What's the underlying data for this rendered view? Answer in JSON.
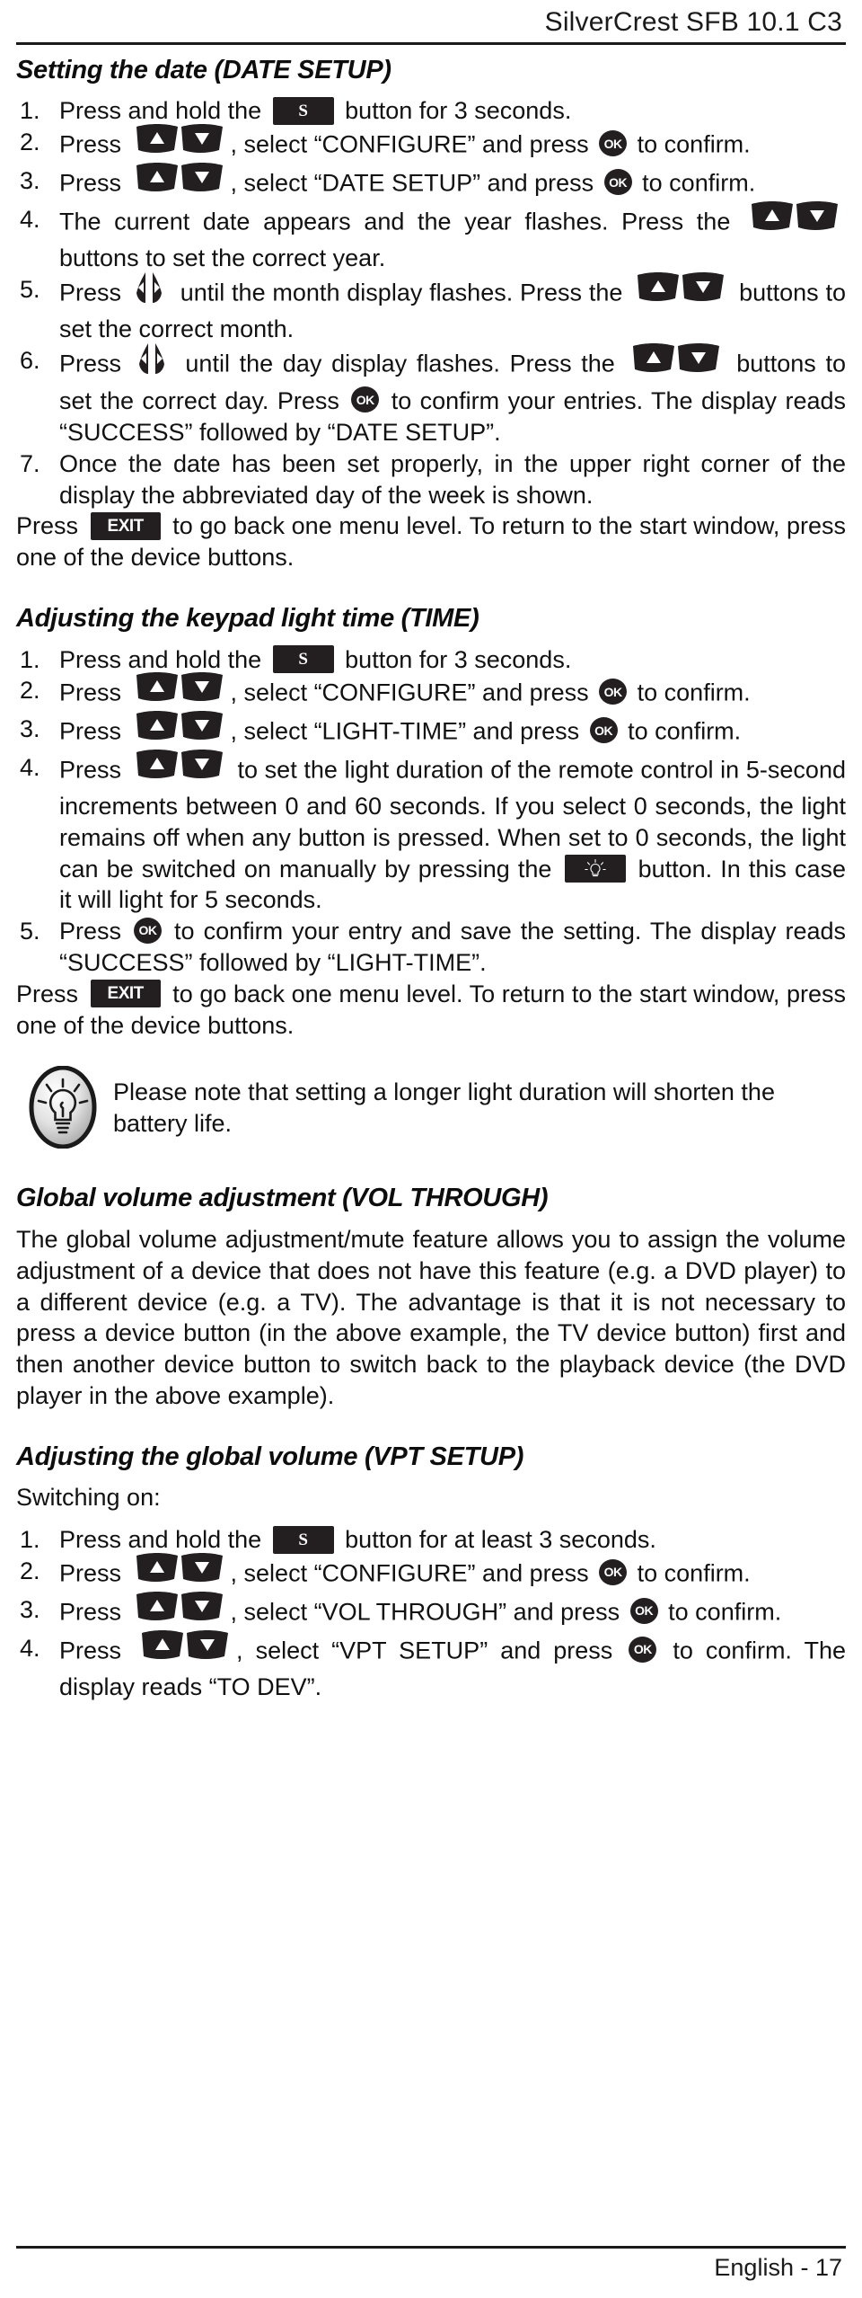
{
  "header": {
    "title": "SilverCrest SFB 10.1 C3"
  },
  "footer": {
    "text": "English - 17"
  },
  "icons": {
    "s_button_label": "S",
    "ok_button_label": "OK",
    "exit_button_label": "EXIT",
    "light_button_name": "light-bulb-icon",
    "updown_name": "up-down-rocker-icon",
    "leftright_name": "left-right-rocker-icon",
    "note_bulb_name": "note-lightbulb-icon"
  },
  "sections": [
    {
      "id": "date-setup",
      "title": "Setting the date (DATE SETUP)",
      "steps": [
        {
          "num": "1.",
          "parts": [
            {
              "t": "text",
              "v": "Press and hold the "
            },
            {
              "t": "icon",
              "v": "s"
            },
            {
              "t": "text",
              "v": " button for 3 seconds."
            }
          ]
        },
        {
          "num": "2.",
          "parts": [
            {
              "t": "text",
              "v": "Press "
            },
            {
              "t": "icon",
              "v": "updown"
            },
            {
              "t": "text",
              "v": ", select “CONFIGURE” and press "
            },
            {
              "t": "icon",
              "v": "ok"
            },
            {
              "t": "text",
              "v": " to confirm."
            }
          ]
        },
        {
          "num": "3.",
          "parts": [
            {
              "t": "text",
              "v": "Press "
            },
            {
              "t": "icon",
              "v": "updown"
            },
            {
              "t": "text",
              "v": ", select “DATE SETUP” and press "
            },
            {
              "t": "icon",
              "v": "ok"
            },
            {
              "t": "text",
              "v": " to confirm."
            }
          ]
        },
        {
          "num": "4.",
          "parts": [
            {
              "t": "text",
              "v": "The current date appears and the year flashes. Press the "
            },
            {
              "t": "icon",
              "v": "updown"
            },
            {
              "t": "text",
              "v": " buttons to set the correct year."
            }
          ]
        },
        {
          "num": "5.",
          "parts": [
            {
              "t": "text",
              "v": "Press "
            },
            {
              "t": "icon",
              "v": "leftright"
            },
            {
              "t": "text",
              "v": " until the month display flashes. Press the "
            },
            {
              "t": "icon",
              "v": "updown"
            },
            {
              "t": "text",
              "v": " buttons to set the correct month."
            }
          ]
        },
        {
          "num": "6.",
          "parts": [
            {
              "t": "text",
              "v": "Press "
            },
            {
              "t": "icon",
              "v": "leftright"
            },
            {
              "t": "text",
              "v": " until the day display flashes. Press the "
            },
            {
              "t": "icon",
              "v": "updown"
            },
            {
              "t": "text",
              "v": " buttons to set the correct day. Press "
            },
            {
              "t": "icon",
              "v": "ok"
            },
            {
              "t": "text",
              "v": " to confirm your entries. The display reads “SUCCESS” followed by “DATE SETUP”."
            }
          ]
        },
        {
          "num": "7.",
          "parts": [
            {
              "t": "text",
              "v": "Once the date has been set properly, in the upper right corner of the display the abbreviated day of the week is shown."
            }
          ]
        }
      ],
      "outro": [
        {
          "t": "text",
          "v": "Press "
        },
        {
          "t": "icon",
          "v": "exit"
        },
        {
          "t": "text",
          "v": " to go back one menu level. To return to the start window, press one of the device buttons."
        }
      ]
    },
    {
      "id": "light-time",
      "title": "Adjusting the keypad light time (TIME)",
      "steps": [
        {
          "num": "1.",
          "parts": [
            {
              "t": "text",
              "v": "Press and hold the "
            },
            {
              "t": "icon",
              "v": "s"
            },
            {
              "t": "text",
              "v": " button for 3 seconds."
            }
          ]
        },
        {
          "num": "2.",
          "parts": [
            {
              "t": "text",
              "v": "Press "
            },
            {
              "t": "icon",
              "v": "updown"
            },
            {
              "t": "text",
              "v": ", select “CONFIGURE” and press "
            },
            {
              "t": "icon",
              "v": "ok"
            },
            {
              "t": "text",
              "v": " to confirm."
            }
          ]
        },
        {
          "num": "3.",
          "parts": [
            {
              "t": "text",
              "v": "Press "
            },
            {
              "t": "icon",
              "v": "updown"
            },
            {
              "t": "text",
              "v": ", select “LIGHT-TIME” and press "
            },
            {
              "t": "icon",
              "v": "ok"
            },
            {
              "t": "text",
              "v": " to confirm."
            }
          ]
        },
        {
          "num": "4.",
          "parts": [
            {
              "t": "text",
              "v": "Press "
            },
            {
              "t": "icon",
              "v": "updown"
            },
            {
              "t": "text",
              "v": " to set the light duration of the remote control in 5-second increments between 0 and 60 seconds. If you select 0 seconds, the light remains off when any button is pressed. When set to 0 seconds, the light can be switched on manually by pressing the "
            },
            {
              "t": "icon",
              "v": "light"
            },
            {
              "t": "text",
              "v": " button. In this case it will light for 5 seconds."
            }
          ]
        },
        {
          "num": "5.",
          "parts": [
            {
              "t": "text",
              "v": "Press "
            },
            {
              "t": "icon",
              "v": "ok"
            },
            {
              "t": "text",
              "v": " to confirm your entry and save the setting. The display reads “SUCCESS” followed by “LIGHT-TIME”."
            }
          ]
        }
      ],
      "outro": [
        {
          "t": "text",
          "v": "Press "
        },
        {
          "t": "icon",
          "v": "exit"
        },
        {
          "t": "text",
          "v": " to go back one menu level. To return to the start window, press one of the device buttons."
        }
      ],
      "note": "Please note that setting a longer light duration will shorten the battery life."
    },
    {
      "id": "vol-through",
      "title": "Global volume adjustment (VOL THROUGH)",
      "body": "The global volume adjustment/mute feature allows you to assign the volume adjustment of a device that does not have this feature (e.g. a DVD player) to a different device (e.g. a TV). The advantage is that it is not necessary to press a device button (in the above example, the TV device button) first and then another device button to switch back to the playback device (the DVD player in the above example)."
    },
    {
      "id": "vpt-setup",
      "title": "Adjusting the global volume (VPT SETUP)",
      "lead": "Switching on:",
      "steps": [
        {
          "num": "1.",
          "parts": [
            {
              "t": "text",
              "v": "Press and hold the "
            },
            {
              "t": "icon",
              "v": "s"
            },
            {
              "t": "text",
              "v": " button for at least 3 seconds."
            }
          ]
        },
        {
          "num": "2.",
          "parts": [
            {
              "t": "text",
              "v": "Press "
            },
            {
              "t": "icon",
              "v": "updown"
            },
            {
              "t": "text",
              "v": ", select “CONFIGURE” and press "
            },
            {
              "t": "icon",
              "v": "ok"
            },
            {
              "t": "text",
              "v": " to confirm."
            }
          ]
        },
        {
          "num": "3.",
          "parts": [
            {
              "t": "text",
              "v": "Press "
            },
            {
              "t": "icon",
              "v": "updown"
            },
            {
              "t": "text",
              "v": ", select “VOL THROUGH” and press "
            },
            {
              "t": "icon",
              "v": "ok"
            },
            {
              "t": "text",
              "v": " to confirm."
            }
          ]
        },
        {
          "num": "4.",
          "parts": [
            {
              "t": "text",
              "v": "Press "
            },
            {
              "t": "icon",
              "v": "updown"
            },
            {
              "t": "text",
              "v": ", select “VPT SETUP” and press "
            },
            {
              "t": "icon",
              "v": "ok"
            },
            {
              "t": "text",
              "v": " to confirm. The display reads “TO DEV”."
            }
          ]
        }
      ]
    }
  ]
}
